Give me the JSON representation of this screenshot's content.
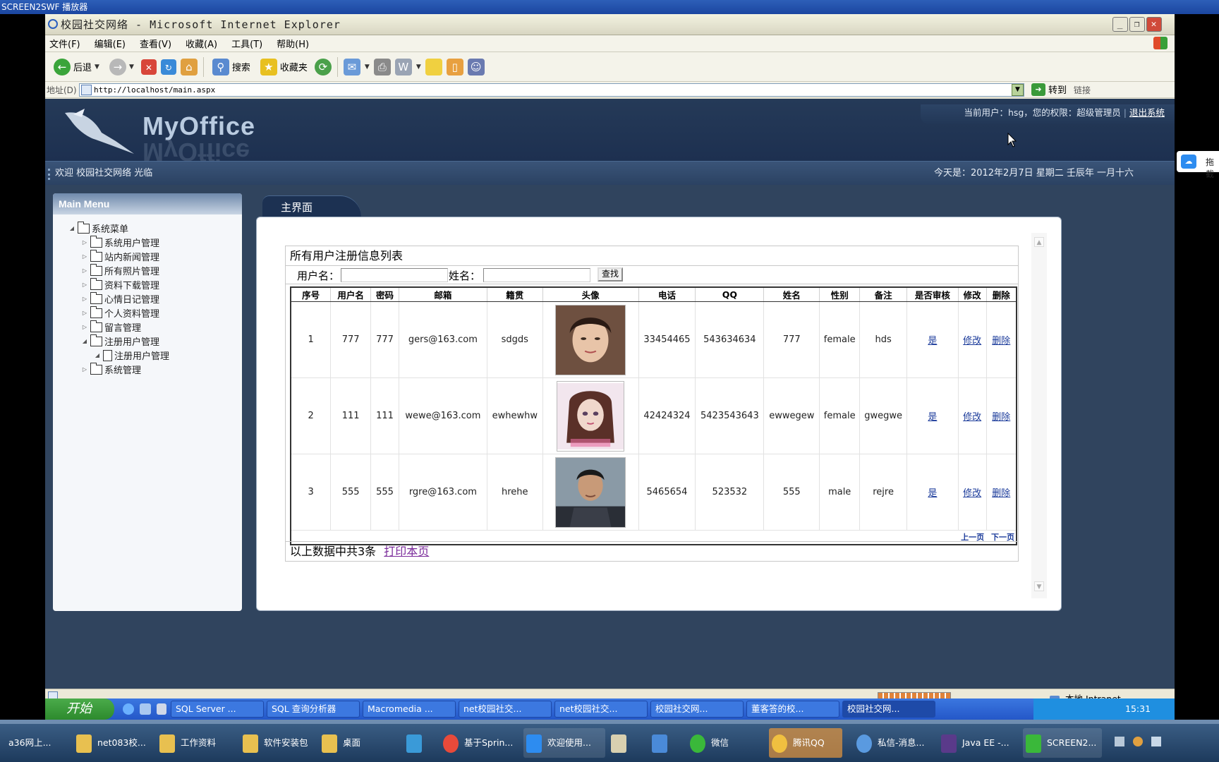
{
  "player": {
    "title": "SCREEN2SWF 播放器"
  },
  "side_widget": {
    "label": "拖截"
  },
  "window": {
    "title": "校园社交网络 - Microsoft Internet Explorer",
    "menu": [
      "文件(F)",
      "编辑(E)",
      "查看(V)",
      "收藏(A)",
      "工具(T)",
      "帮助(H)"
    ],
    "toolbar": {
      "back": "后退",
      "search": "搜索",
      "favorites": "收藏夹"
    },
    "address": {
      "label": "地址(D)",
      "url": "http://localhost/main.aspx",
      "go": "转到",
      "links": "链接"
    }
  },
  "header": {
    "logo": "MyOffice",
    "current_user": "当前用户：hsg，您的权限：超级管理员",
    "logout": "退出系统",
    "welcome": "欢迎 校园社交网络 光临",
    "date": "今天是：2012年2月7日 星期二 壬辰年 一月十六"
  },
  "menu": {
    "title": "Main Menu",
    "root": "系统菜单",
    "items": [
      "系统用户管理",
      "站内新闻管理",
      "所有照片管理",
      "资料下载管理",
      "心情日记管理",
      "个人资料管理",
      "留言管理",
      "注册用户管理",
      "注册用户管理",
      "系统管理"
    ]
  },
  "main": {
    "tab": "主界面",
    "list_title": "所有用户注册信息列表",
    "search": {
      "username_label": "用户名：",
      "name_label": "姓名：",
      "button": "查找"
    },
    "columns": [
      "序号",
      "用户名",
      "密码",
      "邮箱",
      "籍贯",
      "头像",
      "电话",
      "QQ",
      "姓名",
      "性别",
      "备注",
      "是否审核",
      "修改",
      "删除"
    ],
    "rows": [
      {
        "id": "1",
        "username": "777",
        "password": "777",
        "email": "gers@163.com",
        "hometown": "sdgds",
        "phone": "33454465",
        "qq": "543634634",
        "name": "777",
        "gender": "female",
        "note": "hds",
        "approved": "是",
        "edit": "修改",
        "delete": "删除"
      },
      {
        "id": "2",
        "username": "111",
        "password": "111",
        "email": "wewe@163.com",
        "hometown": "ewhewhw",
        "phone": "42424324",
        "qq": "5423543643",
        "name": "ewwegew",
        "gender": "female",
        "note": "gwegwe",
        "approved": "是",
        "edit": "修改",
        "delete": "删除"
      },
      {
        "id": "3",
        "username": "555",
        "password": "555",
        "email": "rgre@163.com",
        "hometown": "hrehe",
        "phone": "5465654",
        "qq": "523532",
        "name": "555",
        "gender": "male",
        "note": "rejre",
        "approved": "是",
        "edit": "修改",
        "delete": "删除"
      }
    ],
    "pager": {
      "prev": "上一页",
      "next": "下一页"
    },
    "footer": {
      "summary": "以上数据中共3条",
      "print": "打印本页"
    }
  },
  "statusbar": {
    "zone": "本地 Intranet"
  },
  "inner_taskbar": {
    "start": "开始",
    "buttons": [
      "SQL Server ...",
      "SQL 查询分析器",
      "Macromedia ...",
      "net校园社交...",
      "net校园社交...",
      "校园社交网...",
      "董客答的校...",
      "校园社交网..."
    ],
    "clock": "15:31"
  },
  "outer_taskbar": {
    "buttons": [
      "a36网上...",
      "net083校...",
      "工作资料",
      "软件安装包",
      "桌面",
      "基于Sprin...",
      "欢迎使用...",
      "微信",
      "腾讯QQ",
      "私信-消息...",
      "Java EE -...",
      "SCREEN2..."
    ]
  },
  "colors": {
    "header": "#1d3050",
    "accent_link": "#1a3a9a",
    "print_link": "#7a2a9a"
  }
}
